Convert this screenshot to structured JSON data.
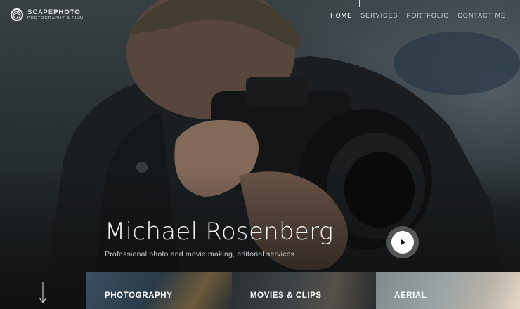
{
  "brand": {
    "name_thin": "SCAPE",
    "name_bold": "PHOTO",
    "tagline": "PHOTOGRAPHY & FILM"
  },
  "nav": {
    "items": [
      "HOME",
      "SERVICES",
      "PORTFOLIO",
      "CONTACT ME"
    ],
    "active": "HOME"
  },
  "hero": {
    "title": "Michael Rosenberg",
    "subtitle": "Professional photo and movie making, editorial services"
  },
  "tiles": [
    {
      "label": "PHOTOGRAPHY"
    },
    {
      "label": "MOVIES & CLIPS"
    },
    {
      "label": "AERIAL"
    }
  ],
  "icons": {
    "logo": "aperture-icon",
    "play": "play-icon",
    "scroll": "arrow-down-icon"
  }
}
